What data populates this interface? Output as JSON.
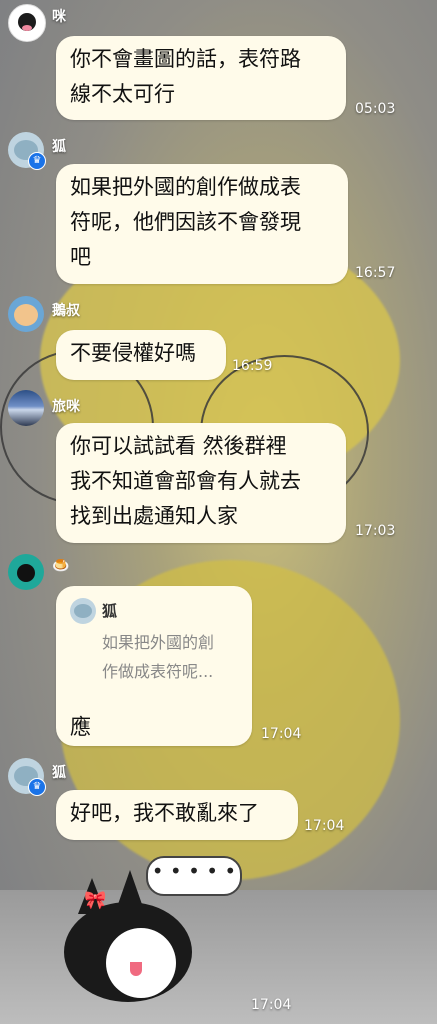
{
  "messages": [
    {
      "sender": "咪",
      "lines": [
        "你不會畫圖的話，表符路",
        "線不太可行"
      ],
      "time": "05:03"
    },
    {
      "sender": "狐",
      "lines": [
        "如果把外國的創作做成表",
        "符呢，他們因該不會發現",
        "吧"
      ],
      "time": "16:57"
    },
    {
      "sender": "鵝叔",
      "lines": [
        "不要侵權好嗎"
      ],
      "time": "16:59"
    },
    {
      "sender": "旅咪",
      "lines": [
        "你可以試試看 然後群裡",
        "我不知道會部會有人就去",
        "找到出處通知人家"
      ],
      "time": "17:03"
    },
    {
      "sender_emoji": "🍮",
      "reply": {
        "name": "狐",
        "lines": [
          "如果把外國的創",
          "作做成表符呢..."
        ]
      },
      "text": "應",
      "time": "17:04"
    },
    {
      "sender": "狐",
      "lines": [
        "好吧，我不敢亂來了"
      ],
      "time": "17:04"
    }
  ],
  "sticker": {
    "speech": "• • • • •",
    "time": "17:04"
  },
  "icons": {
    "crown": "crown-icon"
  }
}
